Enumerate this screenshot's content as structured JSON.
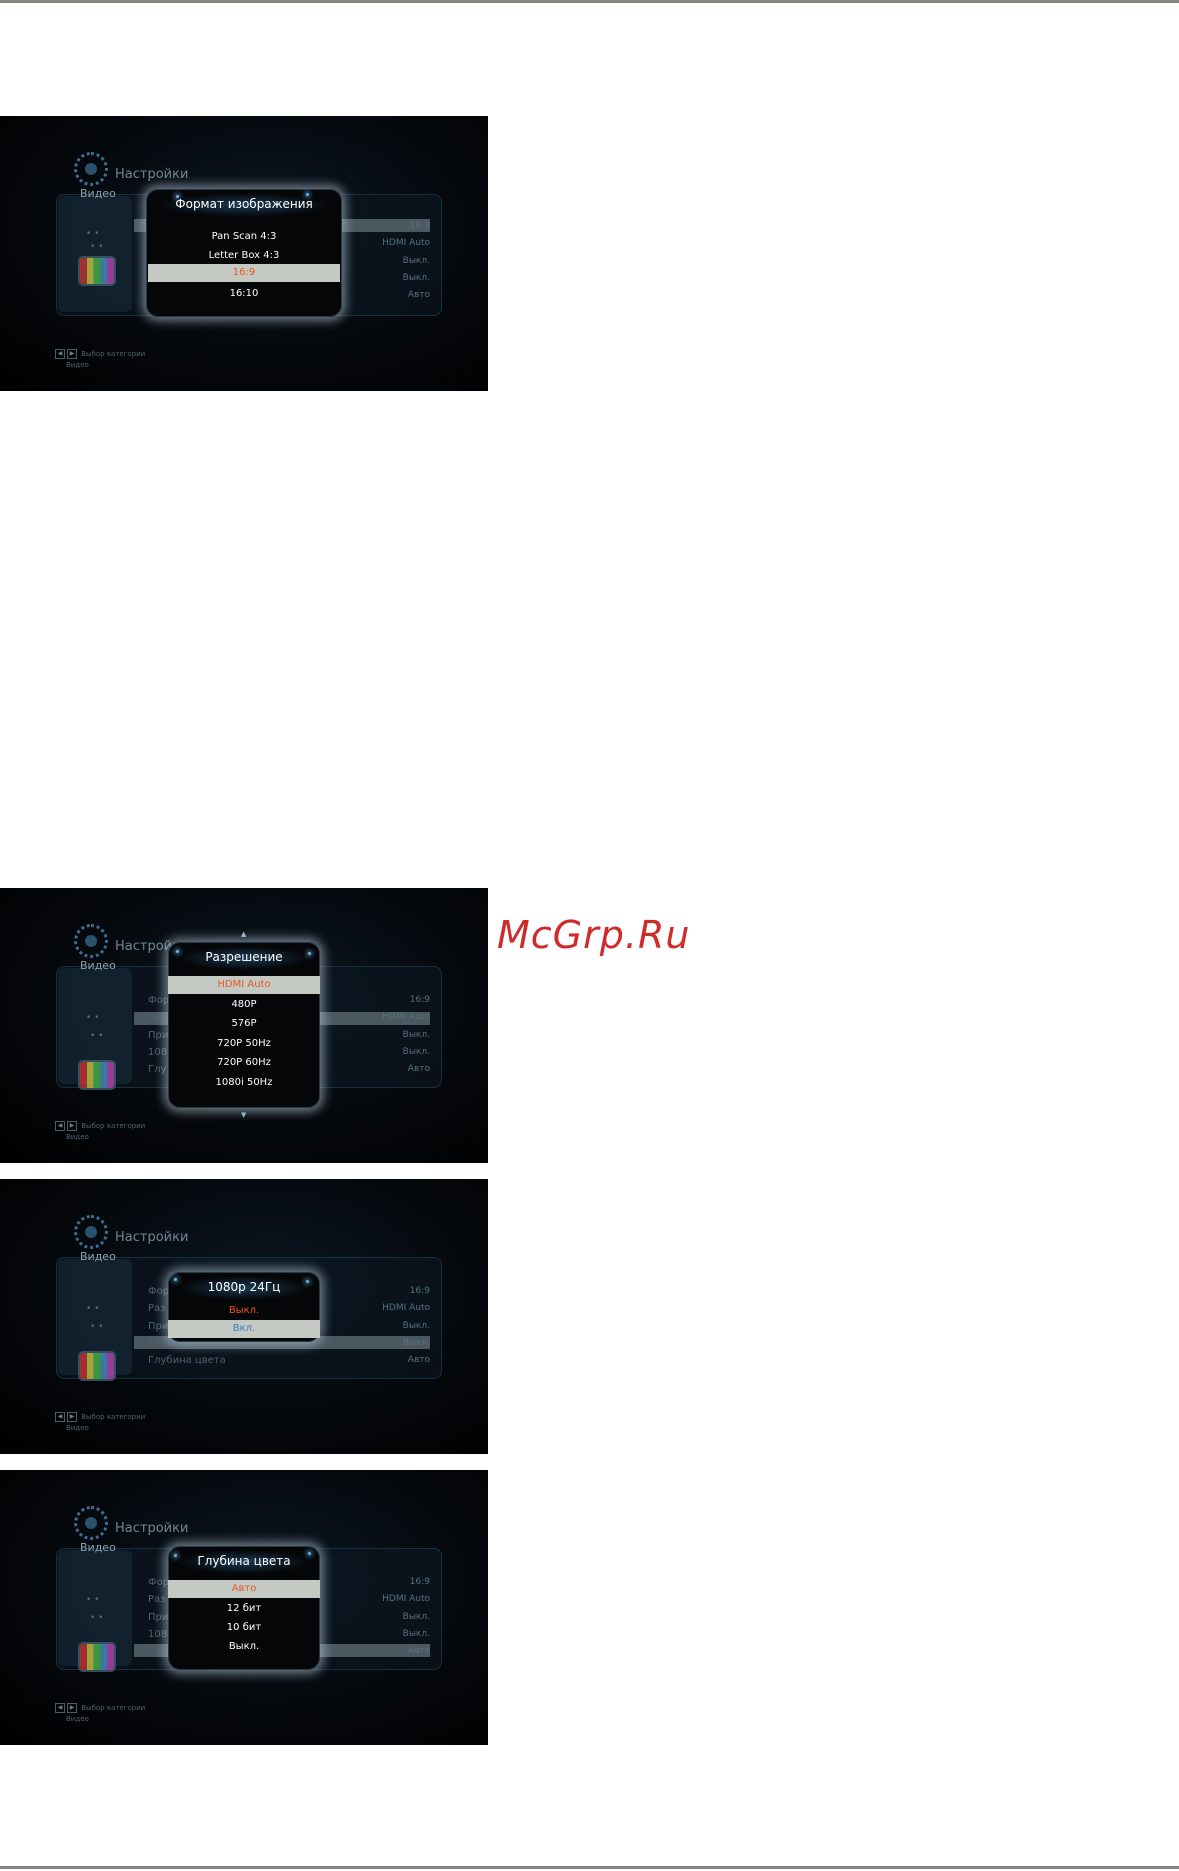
{
  "page_logo": "McGrp.Ru",
  "common": {
    "settings_title": "Настройки",
    "category": "Видео",
    "footer_hint": "Выбор категории",
    "footer_sub": "Видео",
    "setting_values": [
      "16:9",
      "HDMI Auto",
      "Выкл.",
      "Выкл.",
      "Авто"
    ]
  },
  "screens": [
    {
      "popup_title": "Формат изображения",
      "options": [
        "Pan Scan 4:3",
        "Letter Box 4:3",
        "16:9",
        "16:10"
      ],
      "selected_index": 2
    },
    {
      "row_labels": [
        "Фор",
        "Раз",
        "При",
        "1080",
        "Глу"
      ],
      "popup_title": "Разрешение",
      "options": [
        "HDMI Auto",
        "480P",
        "576P",
        "720P 50Hz",
        "720P 60Hz",
        "1080i 50Hz"
      ],
      "selected_index": 0
    },
    {
      "row_labels": [
        "Фор",
        "Раз",
        "При",
        "1080",
        "Глубина цвета"
      ],
      "popup_title": "1080р 24Гц",
      "options": [
        "Выкл.",
        "Вкл."
      ],
      "selected_index": 1
    },
    {
      "row_labels": [
        "Фор",
        "Раз",
        "При",
        "1080",
        "Глу"
      ],
      "popup_title": "Глубина цвета",
      "options": [
        "Авто",
        "12 бит",
        "10 бит",
        "Выкл."
      ],
      "selected_index": 0
    }
  ]
}
